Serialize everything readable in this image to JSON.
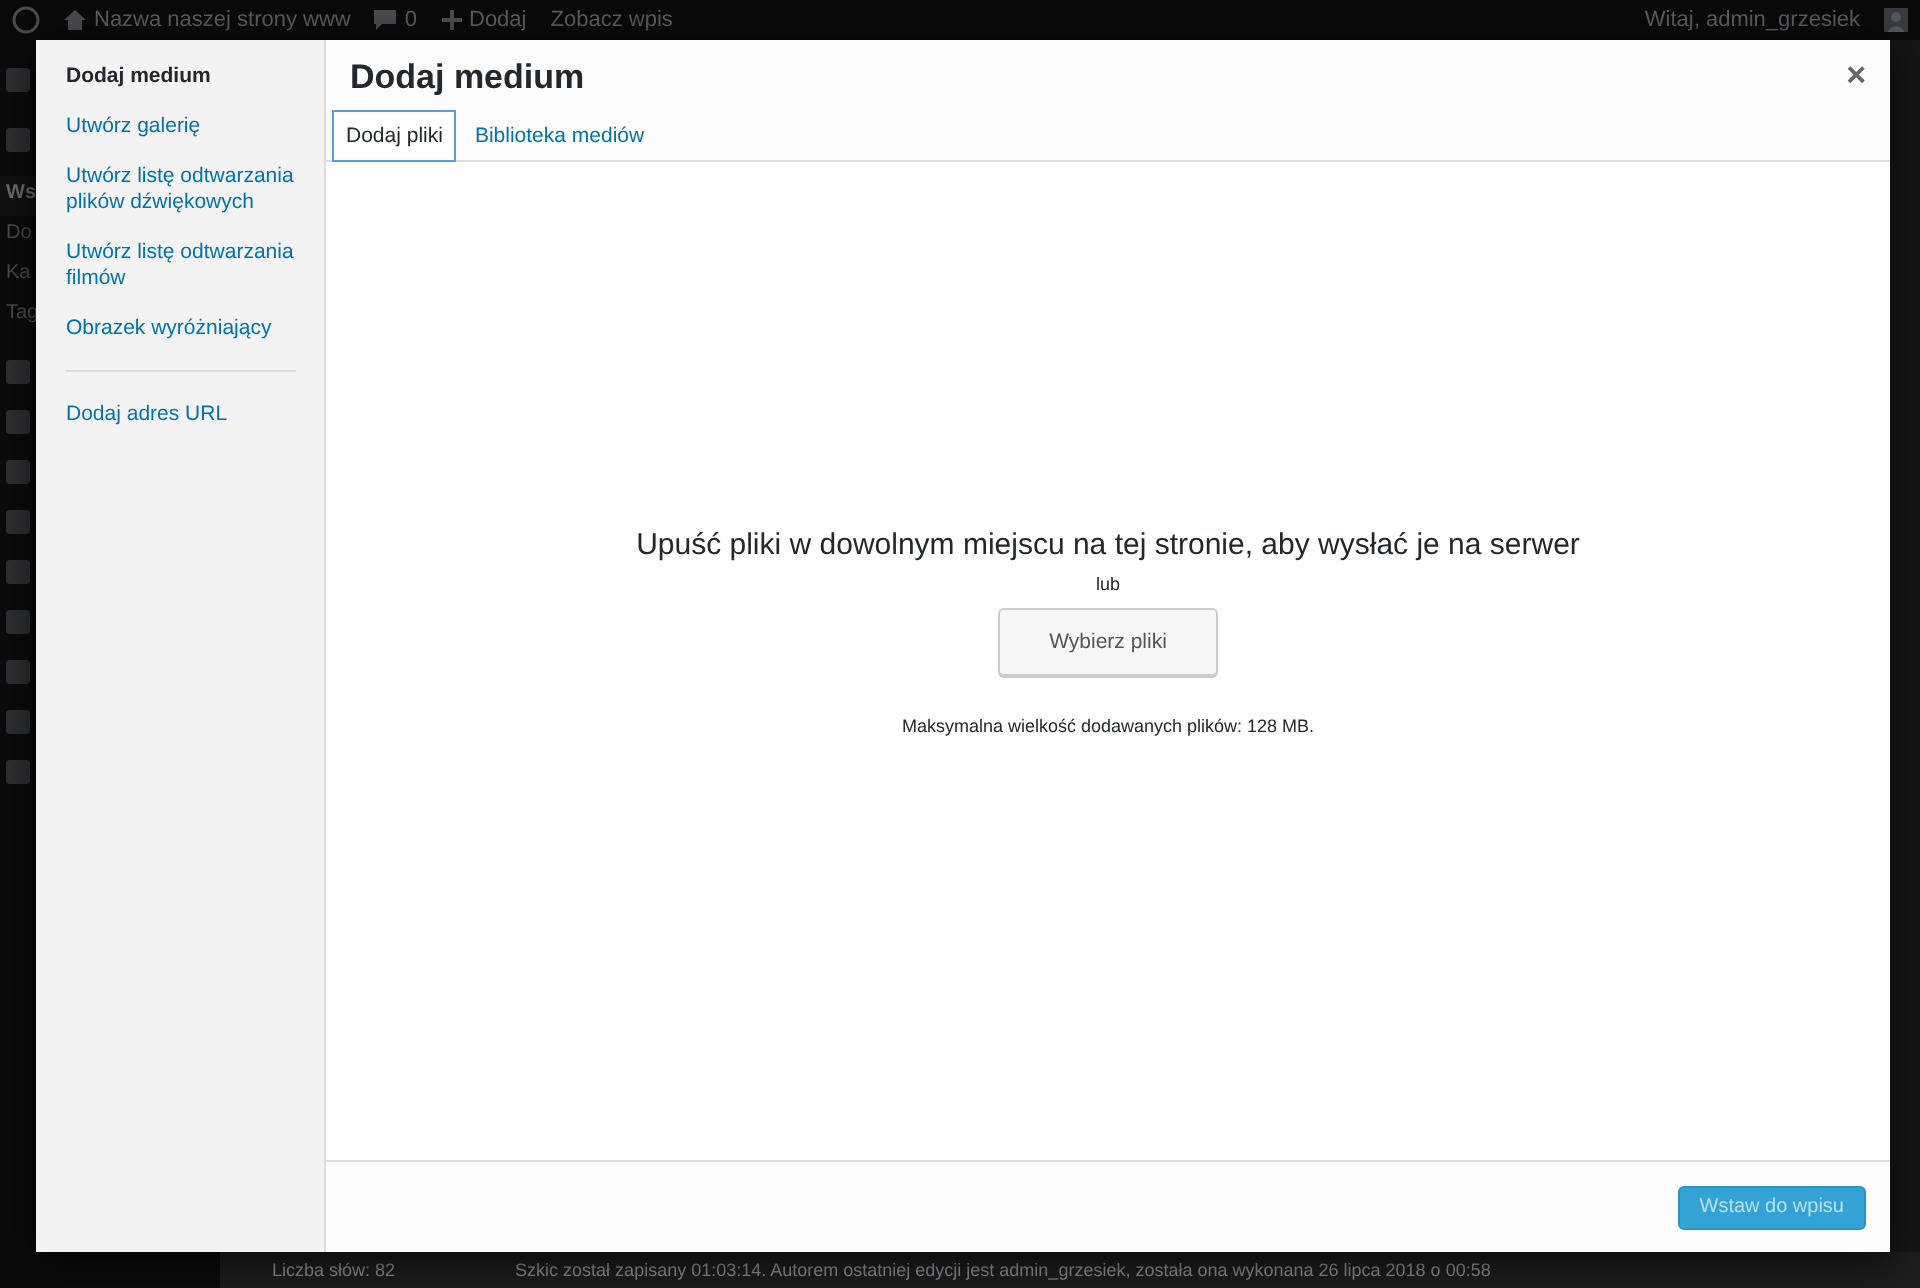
{
  "admin_bar": {
    "site_name": "Nazwa naszej strony www",
    "comments": "0",
    "add_new": "Dodaj",
    "view": "Zobacz wpis",
    "greeting": "Witaj, admin_grzesiek"
  },
  "admin_menu": {
    "items": [
      {
        "label": "Ws",
        "selected": true
      },
      {
        "label": "Do",
        "selected": false
      },
      {
        "label": "Ka",
        "selected": false
      },
      {
        "label": "Tag",
        "selected": false
      }
    ]
  },
  "status_bar": {
    "word_count": "Liczba słów: 82",
    "draft_info": "Szkic został zapisany 01:03:14. Autorem ostatniej edycji jest admin_grzesiek, została ona wykonana 26 lipca 2018 o 00:58"
  },
  "modal": {
    "title": "Dodaj medium",
    "close": "×",
    "menu": [
      {
        "label": "Dodaj medium",
        "selected": true,
        "kind": "item"
      },
      {
        "label": "Utwórz galerię",
        "selected": false,
        "kind": "item"
      },
      {
        "label": "Utwórz listę odtwarzania plików dźwiękowych",
        "selected": false,
        "kind": "item"
      },
      {
        "label": "Utwórz listę odtwarzania filmów",
        "selected": false,
        "kind": "item"
      },
      {
        "label": "Obrazek wyróżniający",
        "selected": false,
        "kind": "item"
      },
      {
        "label": "Dodaj adres URL",
        "selected": false,
        "kind": "separated"
      }
    ],
    "tabs": [
      {
        "label": "Dodaj pliki",
        "selected": true
      },
      {
        "label": "Biblioteka mediów",
        "selected": false
      }
    ],
    "upload": {
      "instructions": "Upuść pliki w dowolnym miejscu na tej stronie, aby wysłać je na serwer",
      "or": "lub",
      "button": "Wybierz pliki",
      "max_size": "Maksymalna wielkość dodawanych plików: 128 MB."
    },
    "insert_button": {
      "label": "Wstaw do wpisu",
      "disabled": true
    }
  }
}
